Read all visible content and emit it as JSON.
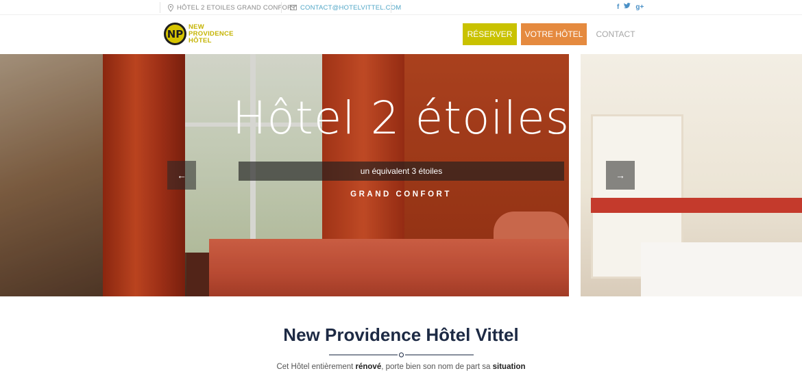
{
  "topbar": {
    "tagline": "HÔTEL 2 ETOILES GRAND CONFORT",
    "email": "CONTACT@HOTELVITTEL.COM",
    "social": [
      "f",
      "t",
      "g+"
    ]
  },
  "logo": {
    "mark": "NP",
    "line1": "NEW",
    "line2": "PROVIDENCE",
    "line3": "HÔTEL"
  },
  "nav": {
    "reserver": "RÉSERVER",
    "votre_hotel": "VOTRE HÔTEL",
    "contact": "CONTACT"
  },
  "hero": {
    "title": "Hôtel 2 étoiles",
    "subtitle": "un équivalent 3 étoiles",
    "tagline": "GRAND CONFORT",
    "prev": "←",
    "next": "→"
  },
  "intro": {
    "title": "New Providence Hôtel Vittel",
    "text_1": "Cet Hôtel entièrement ",
    "text_bold_1": "rénové",
    "text_2": ", porte bien son nom de part sa ",
    "text_bold_2": "situation"
  },
  "colors": {
    "reserver": "#c9c200",
    "votre_hotel": "#e58a3f",
    "title": "#1d2a44",
    "link": "#52a7c7"
  }
}
